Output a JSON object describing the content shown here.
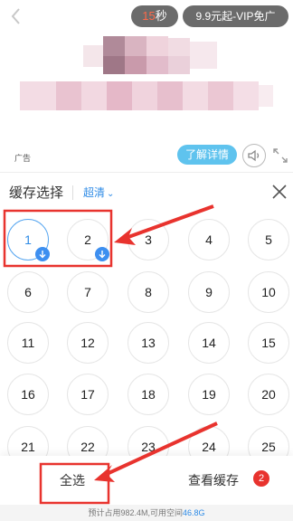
{
  "ad": {
    "countdown_value": "15",
    "countdown_unit": "秒",
    "vip_label": "9.9元起-VIP免广",
    "ad_tag": "广告",
    "learn_more_label": "了解详情"
  },
  "cache_panel": {
    "title": "缓存选择",
    "quality_label": "超清",
    "episodes": [
      {
        "num": "1",
        "state": "downloading"
      },
      {
        "num": "2",
        "state": "downloading"
      },
      {
        "num": "3",
        "state": ""
      },
      {
        "num": "4",
        "state": ""
      },
      {
        "num": "5",
        "state": ""
      },
      {
        "num": "6",
        "state": ""
      },
      {
        "num": "7",
        "state": ""
      },
      {
        "num": "8",
        "state": ""
      },
      {
        "num": "9",
        "state": ""
      },
      {
        "num": "10",
        "state": ""
      },
      {
        "num": "11",
        "state": ""
      },
      {
        "num": "12",
        "state": ""
      },
      {
        "num": "13",
        "state": ""
      },
      {
        "num": "14",
        "state": ""
      },
      {
        "num": "15",
        "state": ""
      },
      {
        "num": "16",
        "state": ""
      },
      {
        "num": "17",
        "state": ""
      },
      {
        "num": "18",
        "state": ""
      },
      {
        "num": "19",
        "state": ""
      },
      {
        "num": "20",
        "state": ""
      },
      {
        "num": "21",
        "state": ""
      },
      {
        "num": "22",
        "state": ""
      },
      {
        "num": "23",
        "state": ""
      },
      {
        "num": "24",
        "state": ""
      },
      {
        "num": "25",
        "state": ""
      }
    ],
    "select_all_label": "全选",
    "view_cache_label": "查看缓存",
    "cache_count": "2",
    "storage_prefix": "预计占用982.4M,可用空间",
    "storage_free": "46.8G"
  },
  "colors": {
    "accent": "#2e8be6",
    "annotation_red": "#e8332e",
    "learn_more_bg": "#5fc3ee",
    "pill_bg": "#6b6b6b"
  },
  "icons": [
    "back-icon",
    "volume-icon",
    "fullscreen-icon",
    "close-icon",
    "download-icon",
    "chevron-down-icon"
  ]
}
